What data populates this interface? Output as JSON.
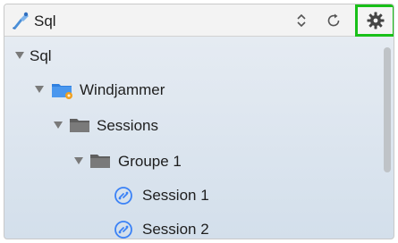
{
  "toolbar": {
    "app_title": "Sql",
    "app_icon": "sql-tool-icon",
    "stepper_icon": "up-down-stepper-icon",
    "refresh_icon": "refresh-icon",
    "settings_icon": "gear-icon",
    "highlight_color": "#19c019"
  },
  "tree": {
    "items": [
      {
        "label": "Sql",
        "level": 0,
        "expanded": true,
        "icon": "none"
      },
      {
        "label": "Windjammer",
        "level": 1,
        "expanded": true,
        "icon": "server-folder-icon"
      },
      {
        "label": "Sessions",
        "level": 2,
        "expanded": true,
        "icon": "folder-icon"
      },
      {
        "label": "Groupe 1",
        "level": 3,
        "expanded": true,
        "icon": "folder-icon"
      },
      {
        "label": "Session 1",
        "level": 4,
        "expanded": false,
        "icon": "session-icon"
      },
      {
        "label": "Session 2",
        "level": 4,
        "expanded": false,
        "icon": "session-icon"
      }
    ]
  },
  "colors": {
    "session_icon": "#3b82f6",
    "folder": "#6e6e6e",
    "server_folder": "#2f7fe0",
    "server_badge": "#f0a020"
  }
}
